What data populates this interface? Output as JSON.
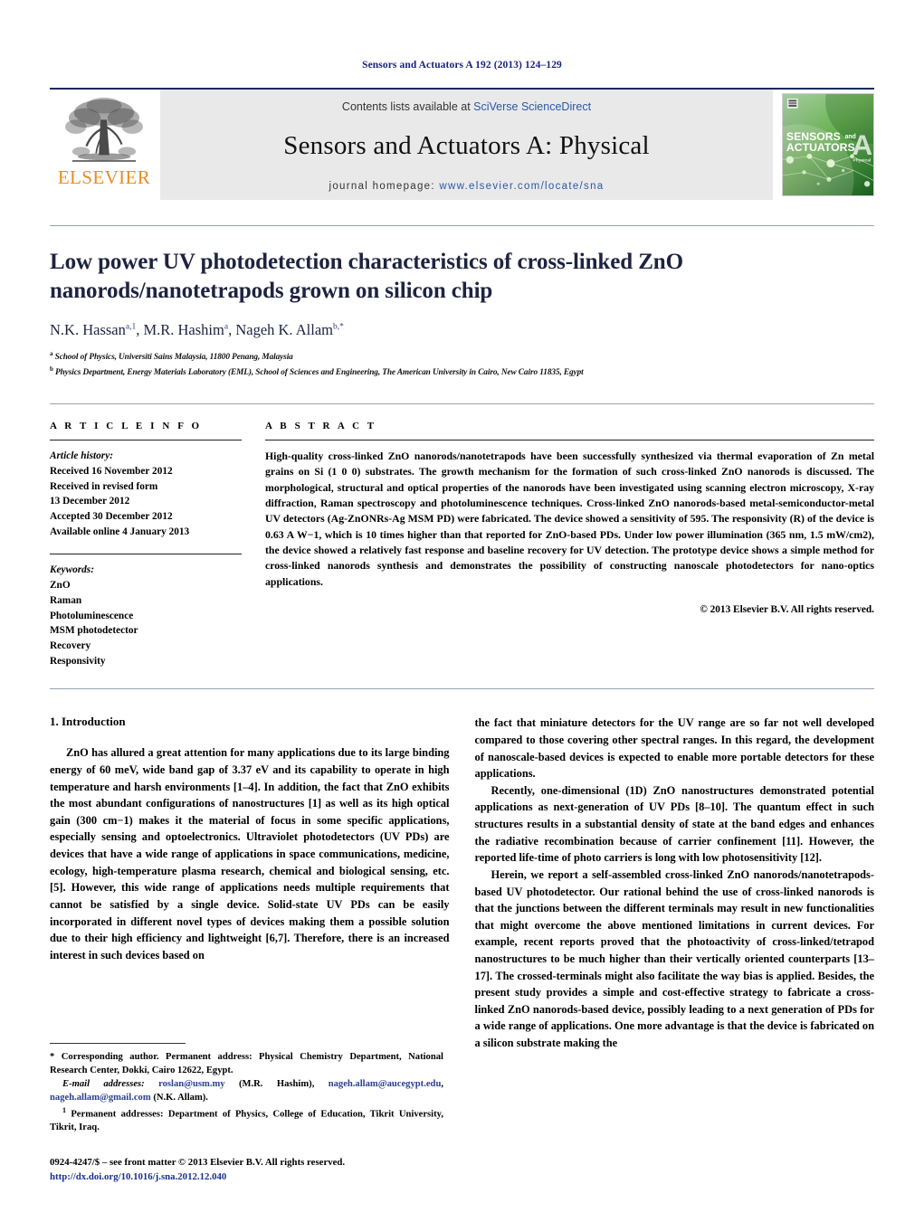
{
  "running_head": "Sensors and Actuators A 192 (2013) 124–129",
  "masthead": {
    "publisher_name": "ELSEVIER",
    "contents_prefix": "Contents lists available at ",
    "contents_link": "SciVerse ScienceDirect",
    "journal_title": "Sensors and Actuators A: Physical",
    "homepage_label": "journal homepage:",
    "homepage_url": "www.elsevier.com/locate/sna",
    "cover_line1": "SENSORS",
    "cover_and": "and",
    "cover_line2": "ACTUATORS",
    "cover_letter": "A",
    "cover_sub": "Physical",
    "accent_green": "#3faa35",
    "link_blue": "#2b57a8",
    "elsevier_orange": "#ee8a22"
  },
  "article": {
    "title": "Low power UV photodetection characteristics of cross-linked ZnO nanorods/nanotetrapods grown on silicon chip",
    "authors_plain": "N.K. Hassan, M.R. Hashim, Nageh K. Allam",
    "authors": [
      {
        "name": "N.K. Hassan",
        "sup": "a,1"
      },
      {
        "name": "M.R. Hashim",
        "sup": "a"
      },
      {
        "name": "Nageh K. Allam",
        "sup": "b,*"
      }
    ],
    "affiliations": [
      {
        "mark": "a",
        "text": "School of Physics, Universiti Sains Malaysia, 11800 Penang, Malaysia"
      },
      {
        "mark": "b",
        "text": "Physics Department, Energy Materials Laboratory (EML), School of Sciences and Engineering, The American University in Cairo, New Cairo 11835, Egypt"
      }
    ]
  },
  "article_info": {
    "heading": "A R T I C L E   I N F O",
    "history_label": "Article history:",
    "history": [
      "Received 16 November 2012",
      "Received in revised form",
      "13 December 2012",
      "Accepted 30 December 2012",
      "Available online 4 January 2013"
    ],
    "keywords_label": "Keywords:",
    "keywords": [
      "ZnO",
      "Raman",
      "Photoluminescence",
      "MSM photodetector",
      "Recovery",
      "Responsivity"
    ]
  },
  "abstract": {
    "heading": "A B S T R A C T",
    "text": "High-quality cross-linked ZnO nanorods/nanotetrapods have been successfully synthesized via thermal evaporation of Zn metal grains on Si (1 0 0) substrates. The growth mechanism for the formation of such cross-linked ZnO nanorods is discussed. The morphological, structural and optical properties of the nanorods have been investigated using scanning electron microscopy, X-ray diffraction, Raman spectroscopy and photoluminescence techniques. Cross-linked ZnO nanorods-based metal-semiconductor-metal UV detectors (Ag-ZnONRs-Ag MSM PD) were fabricated. The device showed a sensitivity of 595. The responsivity (R) of the device is 0.63 A W−1, which is 10 times higher than that reported for ZnO-based PDs. Under low power illumination (365 nm, 1.5 mW/cm2), the device showed a relatively fast response and baseline recovery for UV detection. The prototype device shows a simple method for cross-linked nanorods synthesis and demonstrates the possibility of constructing nanoscale photodetectors for nano-optics applications.",
    "copyright": "© 2013 Elsevier B.V. All rights reserved."
  },
  "body": {
    "section_heading": "1. Introduction",
    "left_paragraphs": [
      "ZnO has allured a great attention for many applications due to its large binding energy of 60 meV, wide band gap of 3.37 eV and its capability to operate in high temperature and harsh environments [1–4]. In addition, the fact that ZnO exhibits the most abundant configurations of nanostructures [1] as well as its high optical gain (300 cm−1) makes it the material of focus in some specific applications, especially sensing and optoelectronics. Ultraviolet photodetectors (UV PDs) are devices that have a wide range of applications in space communications, medicine, ecology, high-temperature plasma research, chemical and biological sensing, etc. [5]. However, this wide range of applications needs multiple requirements that cannot be satisfied by a single device. Solid-state UV PDs can be easily incorporated in different novel types of devices making them a possible solution due to their high efficiency and lightweight [6,7]. Therefore, there is an increased interest in such devices based on"
    ],
    "right_paragraphs": [
      "the fact that miniature detectors for the UV range are so far not well developed compared to those covering other spectral ranges. In this regard, the development of nanoscale-based devices is expected to enable more portable detectors for these applications.",
      "Recently, one-dimensional (1D) ZnO nanostructures demonstrated potential applications as next-generation of UV PDs [8–10]. The quantum effect in such structures results in a substantial density of state at the band edges and enhances the radiative recombination because of carrier confinement [11]. However, the reported life-time of photo carriers is long with low photosensitivity [12].",
      "Herein, we report a self-assembled cross-linked ZnO nanorods/nanotetrapods-based UV photodetector. Our rational behind the use of cross-linked nanorods is that the junctions between the different terminals may result in new functionalities that might overcome the above mentioned limitations in current devices. For example, recent reports proved that the photoactivity of cross-linked/tetrapod nanostructures to be much higher than their vertically oriented counterparts [13–17]. The crossed-terminals might also facilitate the way bias is applied. Besides, the present study provides a simple and cost-effective strategy to fabricate a cross-linked ZnO nanorods-based device, possibly leading to a next generation of PDs for a wide range of applications. One more advantage is that the device is fabricated on a silicon substrate making the"
    ]
  },
  "footnotes": {
    "corresponding": "* Corresponding author. Permanent address: Physical Chemistry Department, National Research Center, Dokki, Cairo 12622, Egypt.",
    "email_label": "E-mail addresses:",
    "emails": [
      {
        "address": "roslan@usm.my",
        "owner": "(M.R. Hashim)"
      },
      {
        "address": "nageh.allam@aucegypt.edu",
        "owner": ""
      },
      {
        "address": "nageh.allam@gmail.com",
        "owner": "(N.K. Allam)."
      }
    ],
    "permanent_mark": "1",
    "permanent": "Permanent addresses: Department of Physics, College of Education, Tikrit University, Tikrit, Iraq.",
    "issn_line": "0924-4247/$ – see front matter © 2013 Elsevier B.V. All rights reserved.",
    "doi": "http://dx.doi.org/10.1016/j.sna.2012.12.040"
  }
}
